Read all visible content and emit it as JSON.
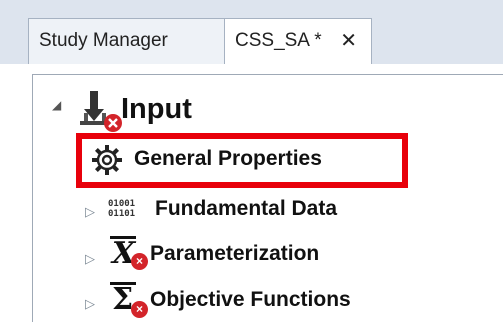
{
  "tabs": [
    {
      "label": "Study Manager"
    },
    {
      "label": "CSS_SA *",
      "close": "✕"
    }
  ],
  "tree": {
    "root": {
      "label": "Input",
      "expander": "◢"
    },
    "children": [
      {
        "label": "General Properties",
        "icon": "gear-icon"
      },
      {
        "label": "Fundamental Data",
        "icon": "binary-data-icon",
        "icon_text": [
          "01001",
          "01101"
        ]
      },
      {
        "label": "Parameterization",
        "icon": "x-variable-icon",
        "icon_text": "X"
      },
      {
        "label": "Objective Functions",
        "icon": "sigma-icon",
        "icon_text": "Σ"
      }
    ],
    "collapsed_expander": "▷"
  },
  "colors": {
    "highlight": "#e8000b",
    "error_badge": "#d3242a"
  }
}
